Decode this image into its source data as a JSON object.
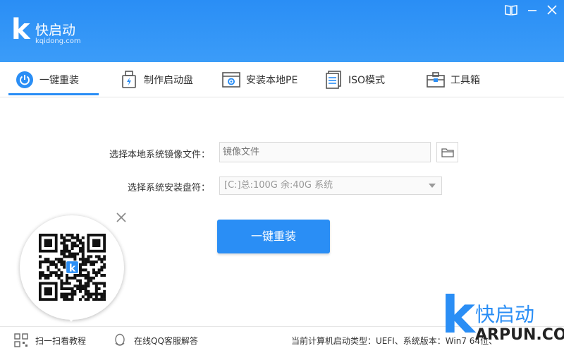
{
  "app": {
    "logo_letter": "k",
    "name": "快启动",
    "domain": "kqidong.com",
    "brand_color": "#2a8ef5"
  },
  "window_controls": [
    {
      "icon": "book-icon",
      "glyph": "🕮"
    },
    {
      "icon": "minimize-icon",
      "glyph": "—"
    },
    {
      "icon": "close-icon",
      "glyph": "✕"
    }
  ],
  "tabs": [
    {
      "label": "一键重装",
      "icon": "power-icon",
      "active": true
    },
    {
      "label": "制作启动盘",
      "icon": "usb-drive-icon",
      "active": false
    },
    {
      "label": "安装本地PE",
      "icon": "pe-install-icon",
      "active": false
    },
    {
      "label": "ISO模式",
      "icon": "iso-file-icon",
      "active": false
    },
    {
      "label": "工具箱",
      "icon": "toolbox-icon",
      "active": false
    }
  ],
  "form": {
    "image_label": "选择本地系统镜像文件：",
    "image_placeholder": "镜像文件",
    "disk_label": "选择系统安装盘符：",
    "disk_selected": "[C:]总:100G 余:40G 系统"
  },
  "primary_button": "一键重装",
  "footer": {
    "scan_label": "扫一扫看教程",
    "qq_label": "在线QQ客服解答",
    "status": "当前计算机启动类型：UEFI、系统版本：Win7 64位、"
  },
  "qr_center_letter": "k",
  "watermark": {
    "letter": "k",
    "name": "快启动",
    "domain": "ARPUN.COM"
  }
}
